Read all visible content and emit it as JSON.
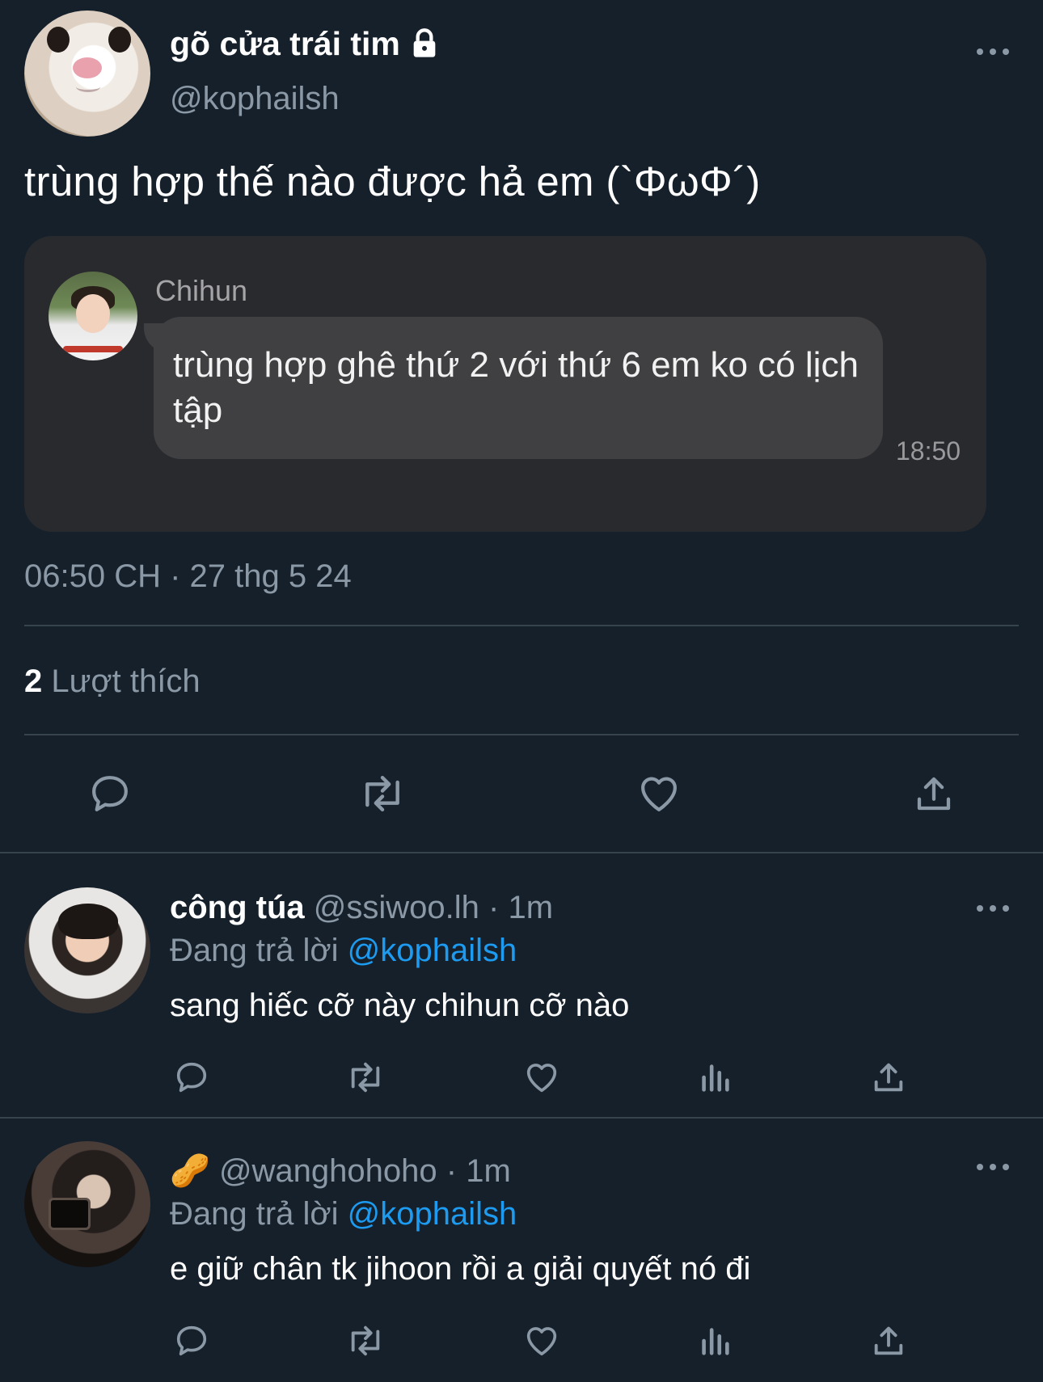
{
  "tweet": {
    "display_name": "gõ cửa trái tim",
    "handle": "@kophailsh",
    "text": "trùng hợp thế nào được hả em (`ΦωΦ´)",
    "timestamp": "06:50 CH · 27 thg 5 24",
    "likes_count": "2",
    "likes_label": "Lượt thích"
  },
  "embedded_chat": {
    "sender": "Chihun",
    "message": "trùng hợp ghê thứ 2 với thứ 6 em ko có lịch tập",
    "time": "18:50"
  },
  "replies": [
    {
      "display_name": "công túa",
      "handle_time": "@ssiwoo.lh · 1m",
      "replying_prefix": "Đang trả lời",
      "replying_to": "@kophailsh",
      "text": "sang hiếc cỡ này chihun cỡ nào"
    },
    {
      "display_name": "🥜",
      "handle_time": "@wanghohoho · 1m",
      "replying_prefix": "Đang trả lời",
      "replying_to": "@kophailsh",
      "text": "e giữ chân tk jihoon rồi a giải quyết nó đi"
    }
  ],
  "colors": {
    "background": "#15202b",
    "link": "#1d9bf0",
    "muted": "#8b98a5",
    "divider": "#38444d"
  },
  "icons": {
    "actions_main": [
      "reply-icon",
      "retweet-icon",
      "like-icon",
      "share-icon"
    ],
    "actions_reply": [
      "reply-icon",
      "retweet-icon",
      "like-icon",
      "views-icon",
      "share-icon"
    ]
  }
}
